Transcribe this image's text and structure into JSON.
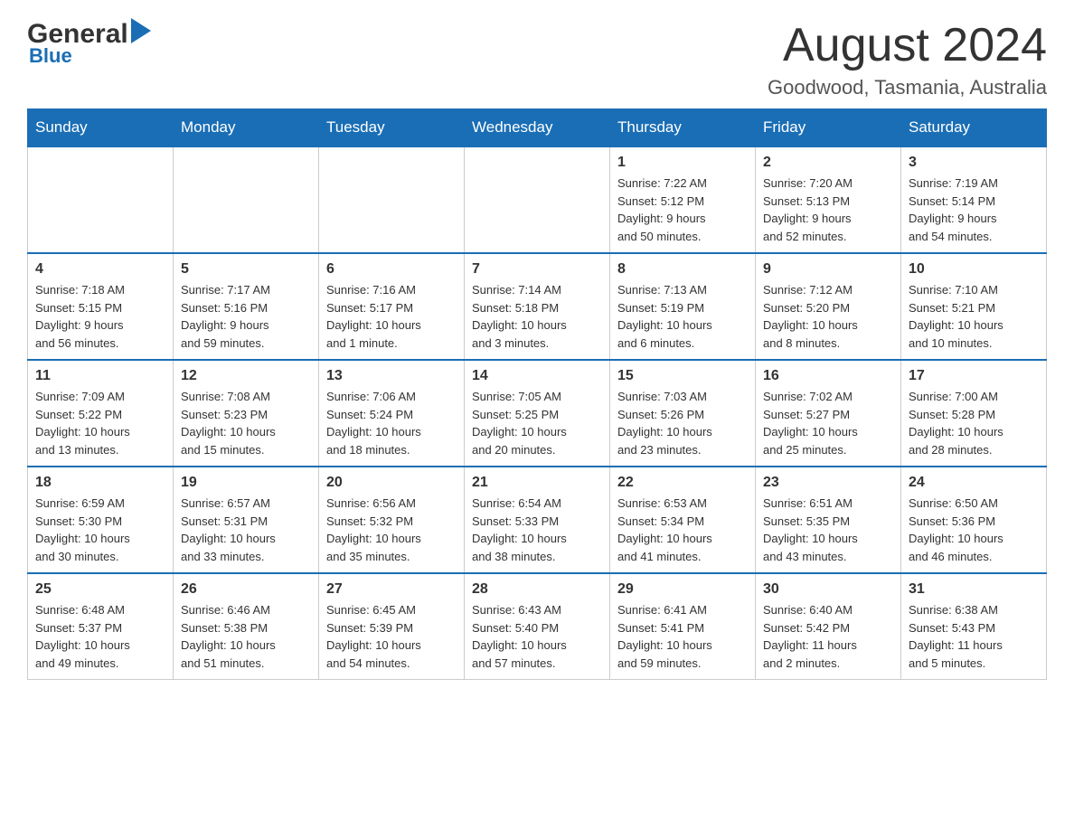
{
  "header": {
    "logo_general": "General",
    "logo_blue": "Blue",
    "title": "August 2024",
    "location": "Goodwood, Tasmania, Australia"
  },
  "weekdays": [
    "Sunday",
    "Monday",
    "Tuesday",
    "Wednesday",
    "Thursday",
    "Friday",
    "Saturday"
  ],
  "weeks": [
    [
      {
        "day": "",
        "info": ""
      },
      {
        "day": "",
        "info": ""
      },
      {
        "day": "",
        "info": ""
      },
      {
        "day": "",
        "info": ""
      },
      {
        "day": "1",
        "info": "Sunrise: 7:22 AM\nSunset: 5:12 PM\nDaylight: 9 hours\nand 50 minutes."
      },
      {
        "day": "2",
        "info": "Sunrise: 7:20 AM\nSunset: 5:13 PM\nDaylight: 9 hours\nand 52 minutes."
      },
      {
        "day": "3",
        "info": "Sunrise: 7:19 AM\nSunset: 5:14 PM\nDaylight: 9 hours\nand 54 minutes."
      }
    ],
    [
      {
        "day": "4",
        "info": "Sunrise: 7:18 AM\nSunset: 5:15 PM\nDaylight: 9 hours\nand 56 minutes."
      },
      {
        "day": "5",
        "info": "Sunrise: 7:17 AM\nSunset: 5:16 PM\nDaylight: 9 hours\nand 59 minutes."
      },
      {
        "day": "6",
        "info": "Sunrise: 7:16 AM\nSunset: 5:17 PM\nDaylight: 10 hours\nand 1 minute."
      },
      {
        "day": "7",
        "info": "Sunrise: 7:14 AM\nSunset: 5:18 PM\nDaylight: 10 hours\nand 3 minutes."
      },
      {
        "day": "8",
        "info": "Sunrise: 7:13 AM\nSunset: 5:19 PM\nDaylight: 10 hours\nand 6 minutes."
      },
      {
        "day": "9",
        "info": "Sunrise: 7:12 AM\nSunset: 5:20 PM\nDaylight: 10 hours\nand 8 minutes."
      },
      {
        "day": "10",
        "info": "Sunrise: 7:10 AM\nSunset: 5:21 PM\nDaylight: 10 hours\nand 10 minutes."
      }
    ],
    [
      {
        "day": "11",
        "info": "Sunrise: 7:09 AM\nSunset: 5:22 PM\nDaylight: 10 hours\nand 13 minutes."
      },
      {
        "day": "12",
        "info": "Sunrise: 7:08 AM\nSunset: 5:23 PM\nDaylight: 10 hours\nand 15 minutes."
      },
      {
        "day": "13",
        "info": "Sunrise: 7:06 AM\nSunset: 5:24 PM\nDaylight: 10 hours\nand 18 minutes."
      },
      {
        "day": "14",
        "info": "Sunrise: 7:05 AM\nSunset: 5:25 PM\nDaylight: 10 hours\nand 20 minutes."
      },
      {
        "day": "15",
        "info": "Sunrise: 7:03 AM\nSunset: 5:26 PM\nDaylight: 10 hours\nand 23 minutes."
      },
      {
        "day": "16",
        "info": "Sunrise: 7:02 AM\nSunset: 5:27 PM\nDaylight: 10 hours\nand 25 minutes."
      },
      {
        "day": "17",
        "info": "Sunrise: 7:00 AM\nSunset: 5:28 PM\nDaylight: 10 hours\nand 28 minutes."
      }
    ],
    [
      {
        "day": "18",
        "info": "Sunrise: 6:59 AM\nSunset: 5:30 PM\nDaylight: 10 hours\nand 30 minutes."
      },
      {
        "day": "19",
        "info": "Sunrise: 6:57 AM\nSunset: 5:31 PM\nDaylight: 10 hours\nand 33 minutes."
      },
      {
        "day": "20",
        "info": "Sunrise: 6:56 AM\nSunset: 5:32 PM\nDaylight: 10 hours\nand 35 minutes."
      },
      {
        "day": "21",
        "info": "Sunrise: 6:54 AM\nSunset: 5:33 PM\nDaylight: 10 hours\nand 38 minutes."
      },
      {
        "day": "22",
        "info": "Sunrise: 6:53 AM\nSunset: 5:34 PM\nDaylight: 10 hours\nand 41 minutes."
      },
      {
        "day": "23",
        "info": "Sunrise: 6:51 AM\nSunset: 5:35 PM\nDaylight: 10 hours\nand 43 minutes."
      },
      {
        "day": "24",
        "info": "Sunrise: 6:50 AM\nSunset: 5:36 PM\nDaylight: 10 hours\nand 46 minutes."
      }
    ],
    [
      {
        "day": "25",
        "info": "Sunrise: 6:48 AM\nSunset: 5:37 PM\nDaylight: 10 hours\nand 49 minutes."
      },
      {
        "day": "26",
        "info": "Sunrise: 6:46 AM\nSunset: 5:38 PM\nDaylight: 10 hours\nand 51 minutes."
      },
      {
        "day": "27",
        "info": "Sunrise: 6:45 AM\nSunset: 5:39 PM\nDaylight: 10 hours\nand 54 minutes."
      },
      {
        "day": "28",
        "info": "Sunrise: 6:43 AM\nSunset: 5:40 PM\nDaylight: 10 hours\nand 57 minutes."
      },
      {
        "day": "29",
        "info": "Sunrise: 6:41 AM\nSunset: 5:41 PM\nDaylight: 10 hours\nand 59 minutes."
      },
      {
        "day": "30",
        "info": "Sunrise: 6:40 AM\nSunset: 5:42 PM\nDaylight: 11 hours\nand 2 minutes."
      },
      {
        "day": "31",
        "info": "Sunrise: 6:38 AM\nSunset: 5:43 PM\nDaylight: 11 hours\nand 5 minutes."
      }
    ]
  ]
}
